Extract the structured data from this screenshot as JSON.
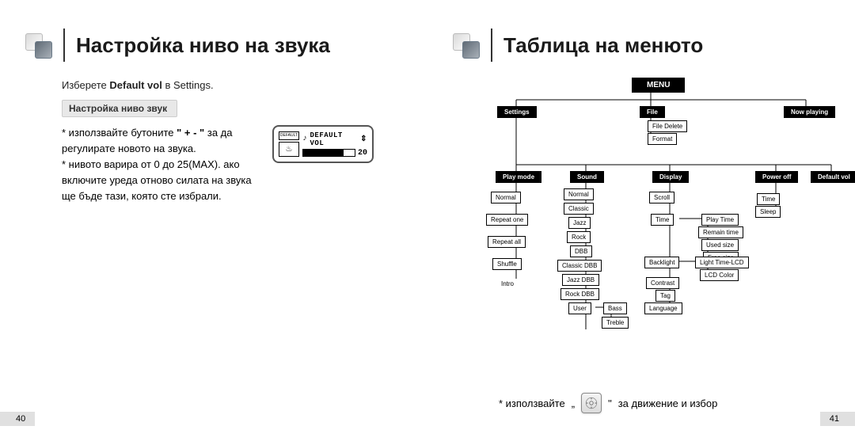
{
  "left": {
    "title": "Настройка ниво на звука",
    "instruction_pre": "Изберете",
    "instruction_bold": "Default vol",
    "instruction_post": "в Settings.",
    "section_label": "Настройка ниво звук",
    "para1_pre": "* използвайте бутоните",
    "para1_bold": "\" + - \"",
    "para1_post": "за да регулирате новото на звука.",
    "para2": "* нивото варира от 0 до 25(MAX). ако включите уреда отново силата на звука ще бъде тази, която сте избрали.",
    "lcd_badge1": "DEFAULT",
    "lcd_title": "DEFAULT VOL",
    "lcd_value": "20",
    "page_num": "40"
  },
  "right": {
    "title": "Таблица на менюто",
    "footnote_pre": "* използвайте",
    "footnote_quote1": "„",
    "footnote_quote2": "\"",
    "footnote_post": "за движение и избор",
    "page_num": "41",
    "menu": {
      "root": "MENU",
      "top": [
        "Settings",
        "File",
        "Now playing"
      ],
      "file_children": [
        "File Delete",
        "Format"
      ],
      "settings_children": [
        "Play mode",
        "Sound",
        "Display",
        "Power off",
        "Default vol"
      ],
      "play_mode": [
        "Normal",
        "Repeat one",
        "Repeat all",
        "Shuffle",
        "Intro"
      ],
      "sound": [
        "Normal",
        "Classic",
        "Jazz",
        "Rock",
        "DBB",
        "Classic DBB",
        "Jazz DBB",
        "Rock DBB",
        "User"
      ],
      "user_children": [
        "Bass",
        "Treble"
      ],
      "display": [
        "Scroll",
        "Time",
        "Backlight",
        "Contrast",
        "Tag",
        "Language"
      ],
      "time_children": [
        "Play Time",
        "Remain time",
        "Used size",
        "Free size"
      ],
      "backlight_children": [
        "Light Time-LCD",
        "LCD Color"
      ],
      "power_off": [
        "Time",
        "Sleep"
      ]
    }
  }
}
